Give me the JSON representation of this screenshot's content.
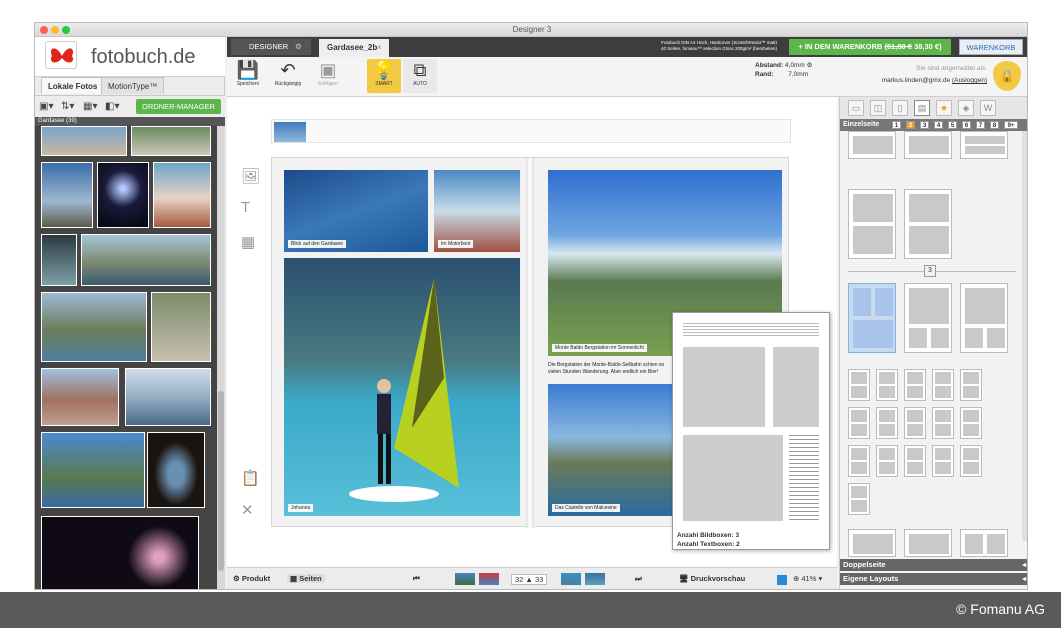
{
  "window": {
    "title": "Designer 3"
  },
  "logo": {
    "text": "fotobuch.de"
  },
  "left": {
    "tabs": [
      {
        "label": "Lokale Fotos"
      },
      {
        "label": "MotionType™"
      }
    ],
    "ordner_button": "ORDNER-MANAGER",
    "folder_header": "Gardasee (39)"
  },
  "tabbar": {
    "designer_label": "DESIGNER",
    "doc_tab": "Gardasee_2b",
    "product_info_line1": "Fotobuch DIN A4 Hoch, Hardcover (ScratchResist™ matt)",
    "product_info_line2": "40 Seiten, fomanu™ selection Gloss 200g/m² (bearbeiten)",
    "cart_label": "IN DEN WARENKORB",
    "old_price": "(51,80 €",
    "new_price": "38,30 €)",
    "warenkorb_label": "WARENKORB"
  },
  "toolbar": {
    "save_label": "Speichern",
    "undo_label": "Rückgängig",
    "insert_label": "Einfügen",
    "smart_label": "SMART",
    "auto_label": "AUTO",
    "abstand_label": "Abstand:",
    "abstand_value": "4,0mm",
    "rand_label": "Rand:",
    "rand_value": "7,0mm",
    "login_text": "Sie sind angemeldet als:",
    "login_user": "markus.linden@gmx.de",
    "logout_label": "(Ausloggen)"
  },
  "spread": {
    "captions": {
      "p1": "Blick auf den Gardasee",
      "p2": "Im Motorboot",
      "p3": "Johanna",
      "p4": "Monte Baldo Bergstation im Sonnenlicht",
      "p5": "Das Castello von Malcesine"
    },
    "body_text": "Die Bergstation der Monte-Baldo-Seilbahn schien so vielen Stunden Wanderung. Aber endlich ein Bier!"
  },
  "popup": {
    "bildboxen_label": "Anzahl Bildboxen:",
    "bildboxen_value": "3",
    "textboxen_label": "Anzahl Textboxen:",
    "textboxen_value": "2"
  },
  "right": {
    "einzelseite_label": "Einzelseite",
    "pages": [
      "1",
      "2",
      "3",
      "4",
      "5",
      "6",
      "7",
      "8",
      "9+"
    ],
    "active_page": "2",
    "section_number": "3",
    "doppelseite_label": "Doppelseite",
    "eigene_label": "Eigene Layouts"
  },
  "bottom": {
    "produkt_label": "Produkt",
    "seiten_label": "Seiten",
    "page_left": "32",
    "page_right": "33",
    "preview_label": "Druckvorschau",
    "zoom": "41%"
  },
  "copyright": "© Fomanu AG",
  "colors": {
    "green": "#5db64b",
    "yellow": "#f3c944",
    "dark": "#3d3d3d"
  }
}
